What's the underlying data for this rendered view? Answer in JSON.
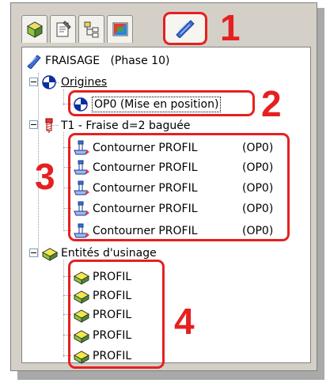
{
  "tabs": [
    {
      "icon": "cube-icon"
    },
    {
      "icon": "properties-icon"
    },
    {
      "icon": "tree-hierarchy-icon"
    },
    {
      "icon": "palette-icon"
    },
    {
      "icon": "toolpath-icon"
    }
  ],
  "tree": {
    "root": {
      "label": "FRAISAGE   (Phase 10)"
    },
    "origines": {
      "label": "Origines",
      "child": "OP0 (Mise en position)"
    },
    "tool": {
      "label": "T1 - Fraise d=2 baguée",
      "operations": [
        {
          "label": "Contourner PROFIL",
          "ref": "(OP0)"
        },
        {
          "label": "Contourner PROFIL",
          "ref": "(OP0)"
        },
        {
          "label": "Contourner PROFIL",
          "ref": "(OP0)"
        },
        {
          "label": "Contourner PROFIL",
          "ref": "(OP0)"
        },
        {
          "label": "Contourner PROFIL",
          "ref": "(OP0)"
        }
      ]
    },
    "entites": {
      "label": "Entités d'usinage",
      "items": [
        {
          "label": "PROFIL"
        },
        {
          "label": "PROFIL"
        },
        {
          "label": "PROFIL"
        },
        {
          "label": "PROFIL"
        },
        {
          "label": "PROFIL"
        }
      ]
    }
  },
  "callouts": {
    "n1": "1",
    "n2": "2",
    "n3": "3",
    "n4": "4"
  },
  "colors": {
    "callout": "#e62020",
    "panel": "#d4d0c8"
  }
}
